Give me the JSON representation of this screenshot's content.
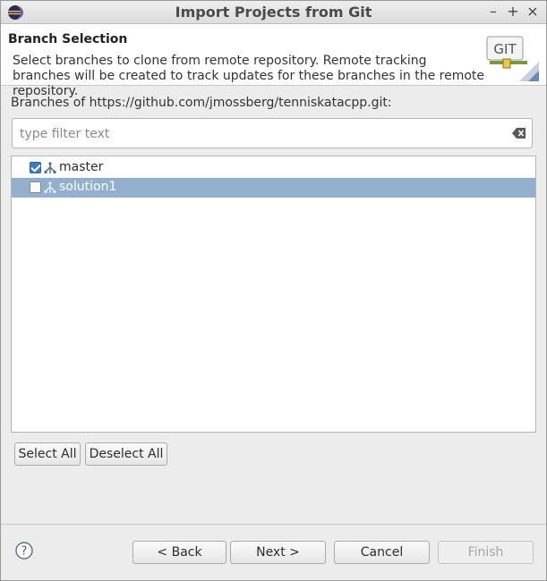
{
  "window": {
    "title": "Import Projects from Git",
    "minimize_glyph": "–",
    "maximize_glyph": "+",
    "close_glyph": "×"
  },
  "header": {
    "title": "Branch Selection",
    "description": "Select branches to clone from remote repository. Remote tracking branches will be created to track updates for these branches in the remote repository.",
    "icon_text": "GIT"
  },
  "repo": {
    "label": "Branches of https://github.com/jmossberg/tenniskatacpp.git:"
  },
  "filter": {
    "placeholder": "type filter text",
    "value": ""
  },
  "branches": [
    {
      "label": "master",
      "checked": true,
      "selected": false
    },
    {
      "label": "solution1",
      "checked": false,
      "selected": true
    }
  ],
  "selection_buttons": {
    "select_all": "Select All",
    "deselect_all": "Deselect All"
  },
  "footer": {
    "back": "< Back",
    "next": "Next >",
    "cancel": "Cancel",
    "finish": "Finish"
  },
  "colors": {
    "selection": "#92b0cd",
    "checkbox_checked": "#3d7ec1"
  },
  "icons": {
    "app": "eclipse-icon",
    "header": "git-icon",
    "branch": "branch-icon",
    "filter_clear": "clear-icon",
    "help": "help-icon"
  }
}
